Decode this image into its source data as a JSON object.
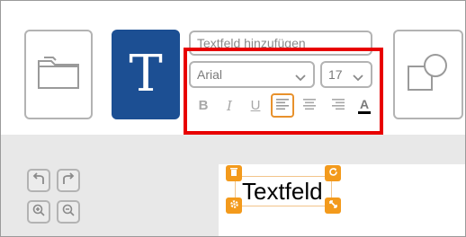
{
  "toolbar": {
    "tools": [
      {
        "name": "open-folder",
        "icon": "folder-icon"
      },
      {
        "name": "text-tool",
        "icon": "text-T-icon",
        "glyph": "T",
        "active_color": "#1c4f93"
      },
      {
        "name": "shape-tool",
        "icon": "shapes-icon"
      }
    ],
    "text_input": {
      "placeholder": "Textfeld hinzufügen"
    },
    "font_select": {
      "value": "Arial"
    },
    "size_select": {
      "value": "17"
    },
    "format_buttons": {
      "bold": "B",
      "italic": "I",
      "underline": "U",
      "text_color": "A"
    },
    "active_alignment": "left",
    "accent_color": "#e8912c"
  },
  "workspace": {
    "canvas_text": "Textfeld",
    "handle_color": "#f39a1c"
  }
}
